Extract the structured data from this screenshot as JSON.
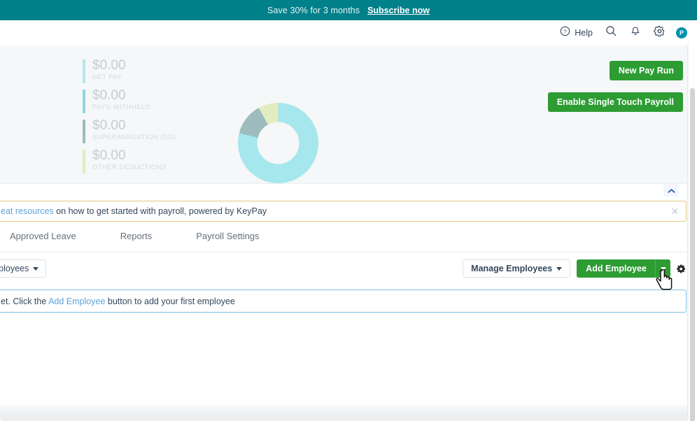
{
  "promo": {
    "text": "Save 30% for 3 months",
    "link": "Subscribe now"
  },
  "header": {
    "help_label": "Help",
    "icons": [
      "help-circle-icon",
      "search-icon",
      "bell-icon",
      "gear-icon"
    ],
    "avatar_initial": "P"
  },
  "summary": {
    "stats": [
      {
        "value": "$0.00",
        "label": "NET PAY",
        "color": "#b2e8ec"
      },
      {
        "value": "$0.00",
        "label": "PAYG WITHHELD",
        "color": "#8ed8e0"
      },
      {
        "value": "$0.00",
        "label": "SUPERANNUATION (SG)",
        "color": "#9cbcbd"
      },
      {
        "value": "$0.00",
        "label": "OTHER DEDUCTIONS",
        "color": "#e3ecc0"
      }
    ],
    "buttons": {
      "new_pay_run": "New Pay Run",
      "enable_stp": "Enable Single Touch Payroll"
    }
  },
  "chart_data": {
    "type": "pie",
    "title": "",
    "categories": [
      "Net pay",
      "Superannuation (SG)",
      "Other deductions"
    ],
    "values": [
      79,
      13,
      8
    ],
    "colors": [
      "#a5e7ec",
      "#9cbcbd",
      "#e3ecc0"
    ],
    "donut": true,
    "legend": "none"
  },
  "collapse": {
    "icon": "chevron-up-icon"
  },
  "alert": {
    "link_text": "eat resources",
    "text": " on how to get started with payroll, powered by KeyPay",
    "close_icon": "close-icon"
  },
  "tabs": [
    {
      "label": "Approved Leave"
    },
    {
      "label": "Reports"
    },
    {
      "label": "Payroll Settings"
    }
  ],
  "toolbar": {
    "filter_label": "e Employees",
    "manage_employees_label": "Manage Employees",
    "add_employee_label": "Add Employee",
    "settings_icon": "gear-icon"
  },
  "empty_state": {
    "prefix": "et. Click the ",
    "link_text": "Add Employee",
    "suffix": " button to add your first employee"
  }
}
